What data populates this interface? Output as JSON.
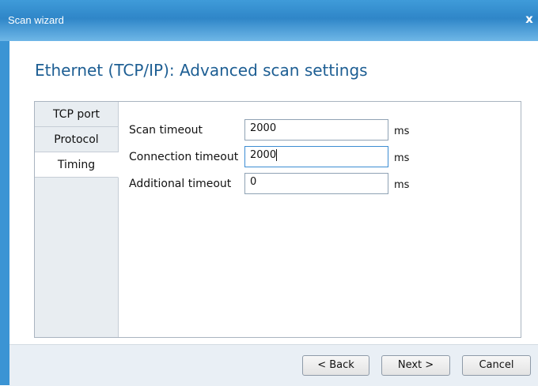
{
  "window": {
    "title": "Scan wizard",
    "close_label": "x"
  },
  "page": {
    "heading": "Ethernet (TCP/IP): Advanced scan settings"
  },
  "tabs": [
    {
      "label": "TCP port",
      "active": false
    },
    {
      "label": "Protocol",
      "active": false
    },
    {
      "label": "Timing",
      "active": true
    }
  ],
  "settings": [
    {
      "label": "Scan timeout",
      "value": "2000",
      "unit": "ms"
    },
    {
      "label": "Connection timeout",
      "value": "2000",
      "unit": "ms"
    },
    {
      "label": "Additional timeout",
      "value": "0",
      "unit": "ms"
    }
  ],
  "buttons": {
    "back": "< Back",
    "next": "Next >",
    "cancel": "Cancel"
  },
  "colors": {
    "titlebar": "#2f86c8",
    "heading": "#1d5e93",
    "focus_border": "#3c8dd3"
  }
}
